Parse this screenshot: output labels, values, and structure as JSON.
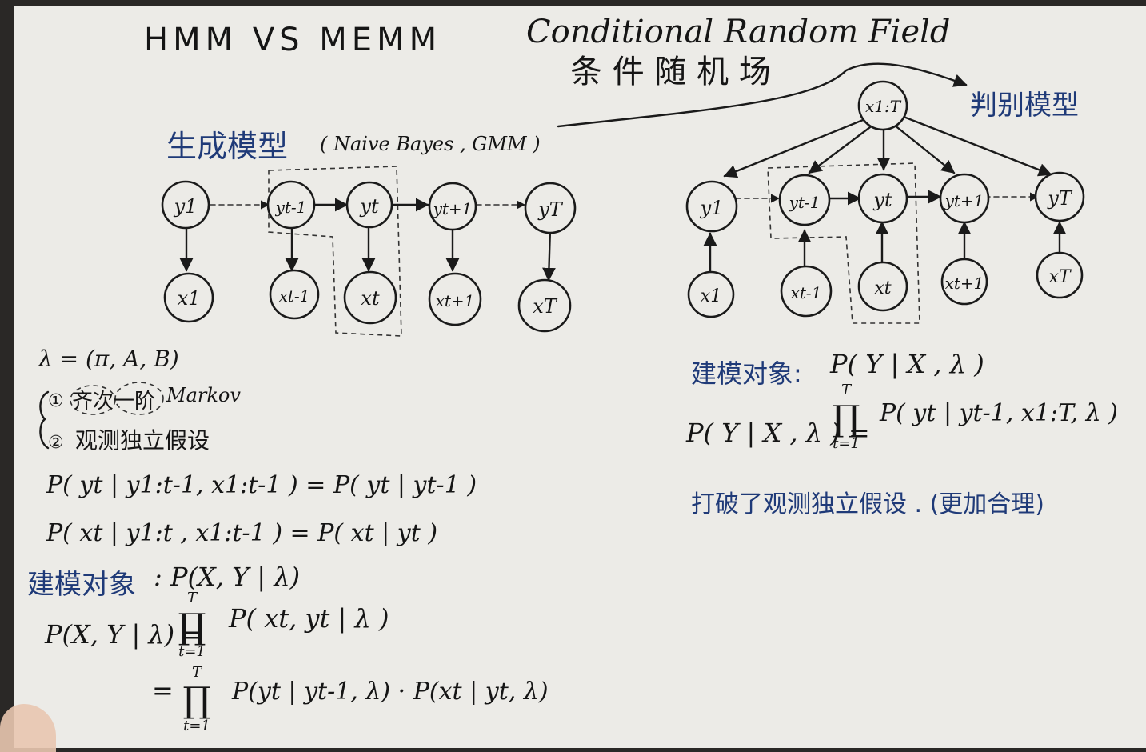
{
  "title_left": "HMM VS MEMM",
  "title_right_en": "Conditional Random Field",
  "title_right_cn": "条 件 随 机 场",
  "discriminative_label": "判别模型",
  "generative_label": "生成模型",
  "generative_examples": "( Naive Bayes , GMM )",
  "hmm": {
    "hidden_nodes": [
      "y1",
      "yt-1",
      "yt",
      "yt+1",
      "yT"
    ],
    "observed_nodes": [
      "x1",
      "xt-1",
      "xt",
      "xt+1",
      "xT"
    ],
    "params": "λ = (π, A, B)",
    "assumption_1_prefix": "①",
    "assumption_1_cn": "齐次一阶",
    "assumption_1_en": "Markov",
    "assumption_2_prefix": "②",
    "assumption_2": "观测独立假设",
    "eq_1": "P( yt | y1:t-1, x1:t-1 ) = P( yt | yt-1 )",
    "eq_2": "P( xt | y1:t , x1:t-1 ) = P( xt | yt )",
    "model_target_label": "建模对象",
    "model_target": ": P(X, Y | λ)",
    "joint_eq_lhs": "P(X, Y | λ) =",
    "joint_eq_prod": "∏",
    "joint_eq_top": "T",
    "joint_eq_bottom": "t=1",
    "joint_eq_rhs": "P( xt, yt | λ )",
    "joint_eq2_lhs": "=",
    "joint_eq2_rhs": "P(yt | yt-1, λ) · P(xt | yt, λ)"
  },
  "memm": {
    "global_node": "x1:T",
    "hidden_nodes": [
      "y1",
      "yt-1",
      "yt",
      "yt+1",
      "yT"
    ],
    "observed_nodes": [
      "x1",
      "xt-1",
      "xt",
      "xt+1",
      "xT"
    ],
    "model_target_label": "建模对象:",
    "model_target": "P( Y | X , λ )",
    "cond_eq_lhs": "P( Y | X , λ ) =",
    "cond_eq_prod": "∏",
    "cond_eq_top": "T",
    "cond_eq_bottom": "t=1",
    "cond_eq_rhs": "P( yt | yt-1, x1:T, λ )",
    "note": "打破了观测独立假设 . (更加合理)"
  },
  "colors": {
    "board": "#ecebe7",
    "ink": "#1a1a1a",
    "blue_ink": "#1f3a78"
  }
}
